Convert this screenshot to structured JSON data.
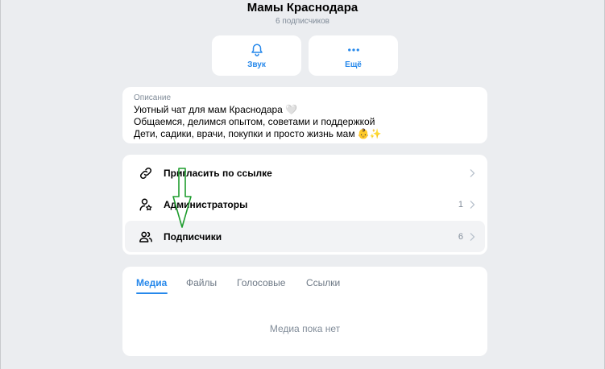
{
  "header": {
    "title": "Мамы Краснодара",
    "subtitle": "6 подписчиков"
  },
  "actions": [
    {
      "label": "Звук",
      "icon": "bell-icon"
    },
    {
      "label": "Ещё",
      "icon": "more-dots-icon"
    }
  ],
  "description": {
    "title": "Описание",
    "lines": [
      "Уютный чат для мам Краснодара 🤍",
      "Общаемся, делимся опытом, советами и поддержкой",
      "Дети, садики, врачи, покупки и просто жизнь мам 👶✨"
    ]
  },
  "menu": [
    {
      "label": "Пригласить по ссылке",
      "icon": "link-icon",
      "count": ""
    },
    {
      "label": "Администраторы",
      "icon": "admin-user-icon",
      "count": "1"
    },
    {
      "label": "Подписчики",
      "icon": "users-icon",
      "count": "6"
    }
  ],
  "media": {
    "tabs": [
      "Медиа",
      "Файлы",
      "Голосовые",
      "Ссылки"
    ],
    "active_tab": "Медиа",
    "empty_text": "Медиа пока нет"
  },
  "colors": {
    "accent": "#2688eb",
    "background": "#ebedf0",
    "annotation_arrow": "#1f9d2e"
  }
}
